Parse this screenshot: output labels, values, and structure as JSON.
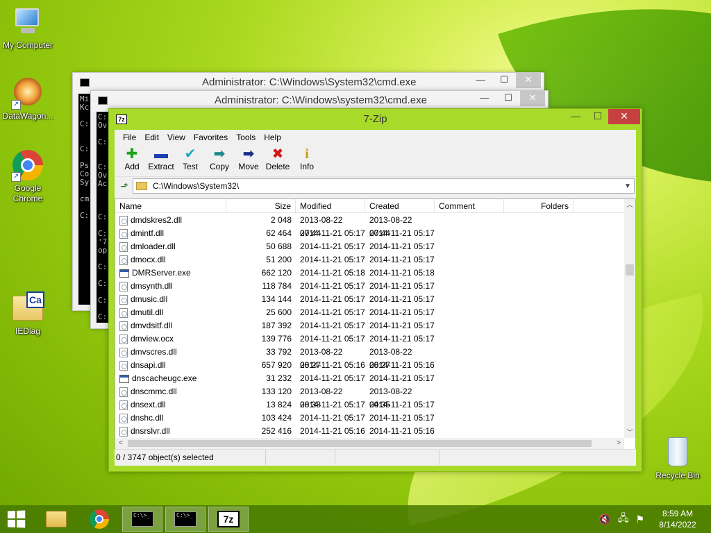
{
  "desktop": {
    "icons": [
      {
        "label": "My Computer",
        "icon": "computer-icon"
      },
      {
        "label": "DataWagon...",
        "icon": "datawagon-icon"
      },
      {
        "label": "Google Chrome",
        "icon": "chrome-icon"
      },
      {
        "label": "IEDiag",
        "icon": "folder-icon"
      },
      {
        "label": "Recycle Bin",
        "icon": "recycle-bin-icon"
      }
    ]
  },
  "cmd_windows": [
    {
      "title": "Administrator: C:\\Windows\\System32\\cmd.exe",
      "console_text": "Mi\nKc\n\nC:\n\n\nC:\n\nPs\nCo\nSy\n\ncm\n\nC:"
    },
    {
      "title": "Administrator: C:\\Windows\\system32\\cmd.exe",
      "console_text": "C:\nOv\n\nC:\n\n\nC:\nOv\nAc\n\n\n\nC:\n\nC:\n'7\nop\n\nC:\n\nC:\n\nC:\n\nC:"
    }
  ],
  "window_controls": {
    "minimize": "—",
    "maximize": "☐",
    "close": "✕"
  },
  "zip": {
    "title": "7-Zip",
    "icon_text": "7z",
    "menu": [
      "File",
      "Edit",
      "View",
      "Favorites",
      "Tools",
      "Help"
    ],
    "toolbar": [
      {
        "label": "Add",
        "glyph": "✚",
        "color": "#1aa31a",
        "icon": "add-icon"
      },
      {
        "label": "Extract",
        "glyph": "▬",
        "color": "#1a3fb0",
        "icon": "extract-icon"
      },
      {
        "label": "Test",
        "glyph": "✔",
        "color": "#19a7c9",
        "icon": "test-icon"
      },
      {
        "label": "Copy",
        "glyph": "➡",
        "color": "#1e8a8a",
        "icon": "copy-icon"
      },
      {
        "label": "Move",
        "glyph": "➡",
        "color": "#1a2f8c",
        "icon": "move-icon"
      },
      {
        "label": "Delete",
        "glyph": "✖",
        "color": "#d01818",
        "icon": "delete-icon"
      },
      {
        "label": "Info",
        "glyph": "i",
        "color": "#c89a10",
        "icon": "info-icon"
      }
    ],
    "path": "C:\\Windows\\System32\\",
    "columns": [
      "Name",
      "Size",
      "Modified",
      "Created",
      "Comment",
      "Folders"
    ],
    "rows": [
      {
        "name": "dmdskres2.dll",
        "size": "2 048",
        "modified": "2013-08-22 07:44",
        "created": "2013-08-22 07:44",
        "type": "dll"
      },
      {
        "name": "dmintf.dll",
        "size": "62 464",
        "modified": "2014-11-21 05:17",
        "created": "2014-11-21 05:17",
        "type": "dll"
      },
      {
        "name": "dmloader.dll",
        "size": "50 688",
        "modified": "2014-11-21 05:17",
        "created": "2014-11-21 05:17",
        "type": "dll"
      },
      {
        "name": "dmocx.dll",
        "size": "51 200",
        "modified": "2014-11-21 05:17",
        "created": "2014-11-21 05:17",
        "type": "dll"
      },
      {
        "name": "DMRServer.exe",
        "size": "662 120",
        "modified": "2014-11-21 05:18",
        "created": "2014-11-21 05:18",
        "type": "exe"
      },
      {
        "name": "dmsynth.dll",
        "size": "118 784",
        "modified": "2014-11-21 05:17",
        "created": "2014-11-21 05:17",
        "type": "dll"
      },
      {
        "name": "dmusic.dll",
        "size": "134 144",
        "modified": "2014-11-21 05:17",
        "created": "2014-11-21 05:17",
        "type": "dll"
      },
      {
        "name": "dmutil.dll",
        "size": "25 600",
        "modified": "2014-11-21 05:17",
        "created": "2014-11-21 05:17",
        "type": "dll"
      },
      {
        "name": "dmvdsitf.dll",
        "size": "187 392",
        "modified": "2014-11-21 05:17",
        "created": "2014-11-21 05:17",
        "type": "dll"
      },
      {
        "name": "dmview.ocx",
        "size": "139 776",
        "modified": "2014-11-21 05:17",
        "created": "2014-11-21 05:17",
        "type": "dll"
      },
      {
        "name": "dmvscres.dll",
        "size": "33 792",
        "modified": "2013-08-22 08:27",
        "created": "2013-08-22 08:27",
        "type": "dll"
      },
      {
        "name": "dnsapi.dll",
        "size": "657 920",
        "modified": "2014-11-21 05:16",
        "created": "2014-11-21 05:16",
        "type": "dll"
      },
      {
        "name": "dnscacheugc.exe",
        "size": "31 232",
        "modified": "2014-11-21 05:17",
        "created": "2014-11-21 05:17",
        "type": "exe"
      },
      {
        "name": "dnscmmc.dll",
        "size": "133 120",
        "modified": "2013-08-22 08:38",
        "created": "2013-08-22 04:35",
        "type": "dll"
      },
      {
        "name": "dnsext.dll",
        "size": "13 824",
        "modified": "2014-11-21 05:17",
        "created": "2014-11-21 05:17",
        "type": "dll"
      },
      {
        "name": "dnshc.dll",
        "size": "103 424",
        "modified": "2014-11-21 05:17",
        "created": "2014-11-21 05:17",
        "type": "dll"
      },
      {
        "name": "dnsrslvr.dll",
        "size": "252 416",
        "modified": "2014-11-21 05:16",
        "created": "2014-11-21 05:16",
        "type": "dll"
      }
    ],
    "status": "0 / 3747 object(s) selected"
  },
  "taskbar": {
    "cmd_icon_text": "C:\\>_",
    "zip_icon_text": "7z",
    "time": "8:59 AM",
    "date": "8/14/2022"
  }
}
